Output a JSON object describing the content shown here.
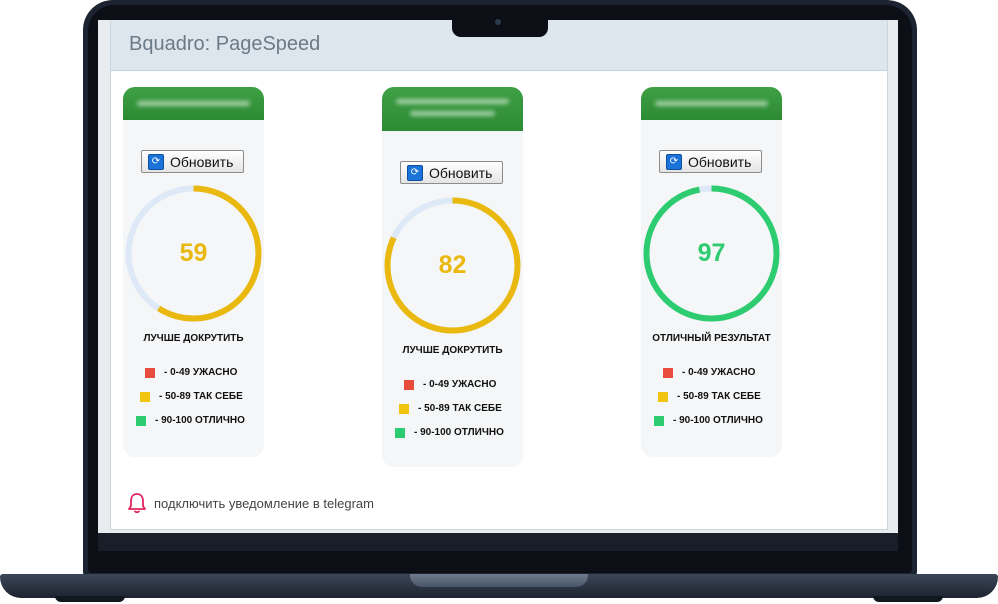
{
  "app_title": "Bquadro: PageSpeed",
  "refresh_label": "Обновить",
  "colors": {
    "bad": "#e74c3c",
    "average": "#f1c40f",
    "good": "#2ecc71",
    "track": "#dde9f7",
    "header_green": "#2e8b35"
  },
  "cards": [
    {
      "score": "59",
      "score_value": 59,
      "verdict": "ЛУЧШЕ ДОКРУТИТЬ",
      "score_color": "#eab90f"
    },
    {
      "score": "82",
      "score_value": 82,
      "verdict": "ЛУЧШЕ ДОКРУТИТЬ",
      "score_color": "#eab90f"
    },
    {
      "score": "97",
      "score_value": 97,
      "verdict": "ОТЛИЧНЫЙ РЕЗУЛЬТАТ",
      "score_color": "#2ecc71"
    }
  ],
  "legend": [
    {
      "label": "- 0-49 УЖАСНО",
      "color": "#e74c3c"
    },
    {
      "label": "- 50-89 ТАК СЕБЕ",
      "color": "#f1c40f"
    },
    {
      "label": "- 90-100 ОТЛИЧНО",
      "color": "#2ecc71"
    }
  ],
  "notification": {
    "label": "подключить уведомление в telegram",
    "icon": "bell-icon"
  }
}
